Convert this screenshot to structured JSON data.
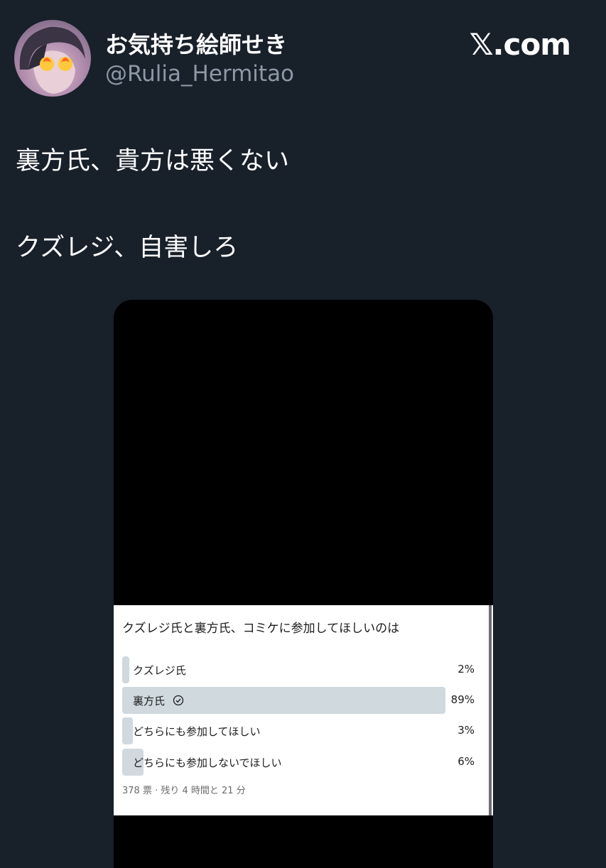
{
  "brand": "𝕏.com",
  "author": {
    "display_name": "お気持ち絵師せき",
    "handle": "@Rulia_Hermitao"
  },
  "tweet": {
    "lines": [
      "裏方氏、貴方は悪くない",
      "クズレジ、自害しろ"
    ]
  },
  "poll": {
    "question": "クズレジ氏と裏方氏、コミケに参加してほしいのは",
    "options": [
      {
        "label": "クズレジ氏",
        "percent_text": "2%",
        "percent": 2,
        "selected": false
      },
      {
        "label": "裏方氏",
        "percent_text": "89%",
        "percent": 89,
        "selected": true
      },
      {
        "label": "どちらにも参加してほしい",
        "percent_text": "3%",
        "percent": 3,
        "selected": false
      },
      {
        "label": "どちらにも参加しないでほしい",
        "percent_text": "6%",
        "percent": 6,
        "selected": false
      }
    ],
    "meta": "378 票 · 残り 4 時間と 21 分"
  },
  "colors": {
    "background": "#18202a",
    "poll_bar": "#cfd9de"
  }
}
